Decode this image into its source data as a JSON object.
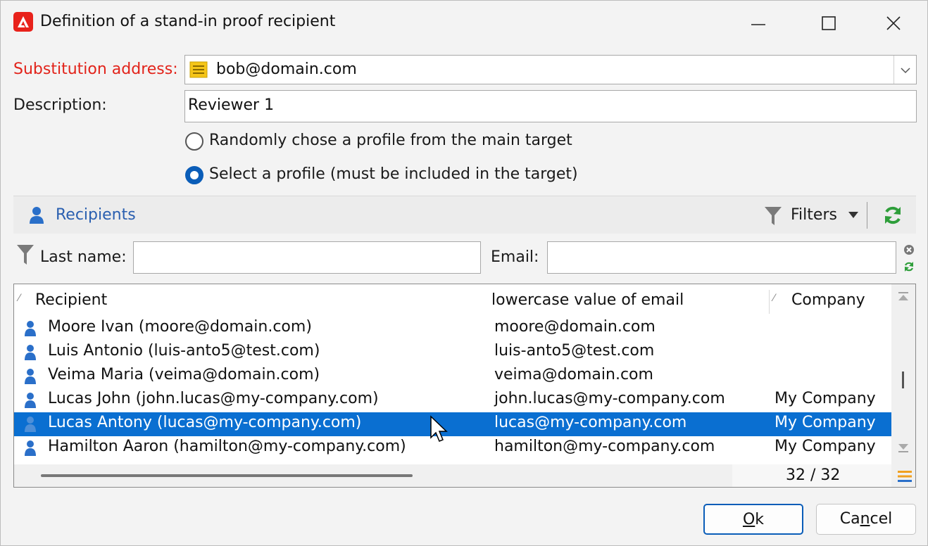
{
  "window": {
    "title": "Definition of a stand-in proof recipient"
  },
  "form": {
    "substitution_label": "Substitution address:",
    "substitution_value": "bob@domain.com",
    "description_label": "Description:",
    "description_value": "Reviewer 1",
    "radio_random_label": "Randomly chose a profile from the main target",
    "radio_select_label": "Select a profile (must be included in the target)",
    "selected_radio": "select"
  },
  "recipients_bar": {
    "title": "Recipients",
    "filters_label": "Filters"
  },
  "filter_row": {
    "last_name_label": "Last name:",
    "last_name_value": "",
    "email_label": "Email:",
    "email_value": ""
  },
  "grid": {
    "columns": [
      "Recipient",
      "lowercase value of email",
      "Company"
    ],
    "rows": [
      {
        "recipient": "Moore Ivan (moore@domain.com)",
        "email": "moore@domain.com",
        "company": ""
      },
      {
        "recipient": "Luis Antonio (luis-anto5@test.com)",
        "email": "luis-anto5@test.com",
        "company": ""
      },
      {
        "recipient": "Veima Maria (veima@domain.com)",
        "email": "veima@domain.com",
        "company": ""
      },
      {
        "recipient": "Lucas John (john.lucas@my-company.com)",
        "email": "john.lucas@my-company.com",
        "company": "My Company"
      },
      {
        "recipient": "Lucas Antony (lucas@my-company.com)",
        "email": "lucas@my-company.com",
        "company": "My Company"
      },
      {
        "recipient": "Hamilton Aaron (hamilton@my-company.com)",
        "email": "hamilton@my-company.com",
        "company": "My Company"
      }
    ],
    "selected_row": 4,
    "count": "32 / 32"
  },
  "buttons": {
    "ok_mnemonic": "O",
    "ok_rest": "k",
    "cancel_pre": "Ca",
    "cancel_mnemonic": "n",
    "cancel_rest": "cel"
  },
  "colors": {
    "accent": "#0a5db8",
    "selection": "#0a6fd1",
    "required_label": "#e2231a",
    "link": "#2a5fb0",
    "refresh": "#2e9e3a"
  }
}
